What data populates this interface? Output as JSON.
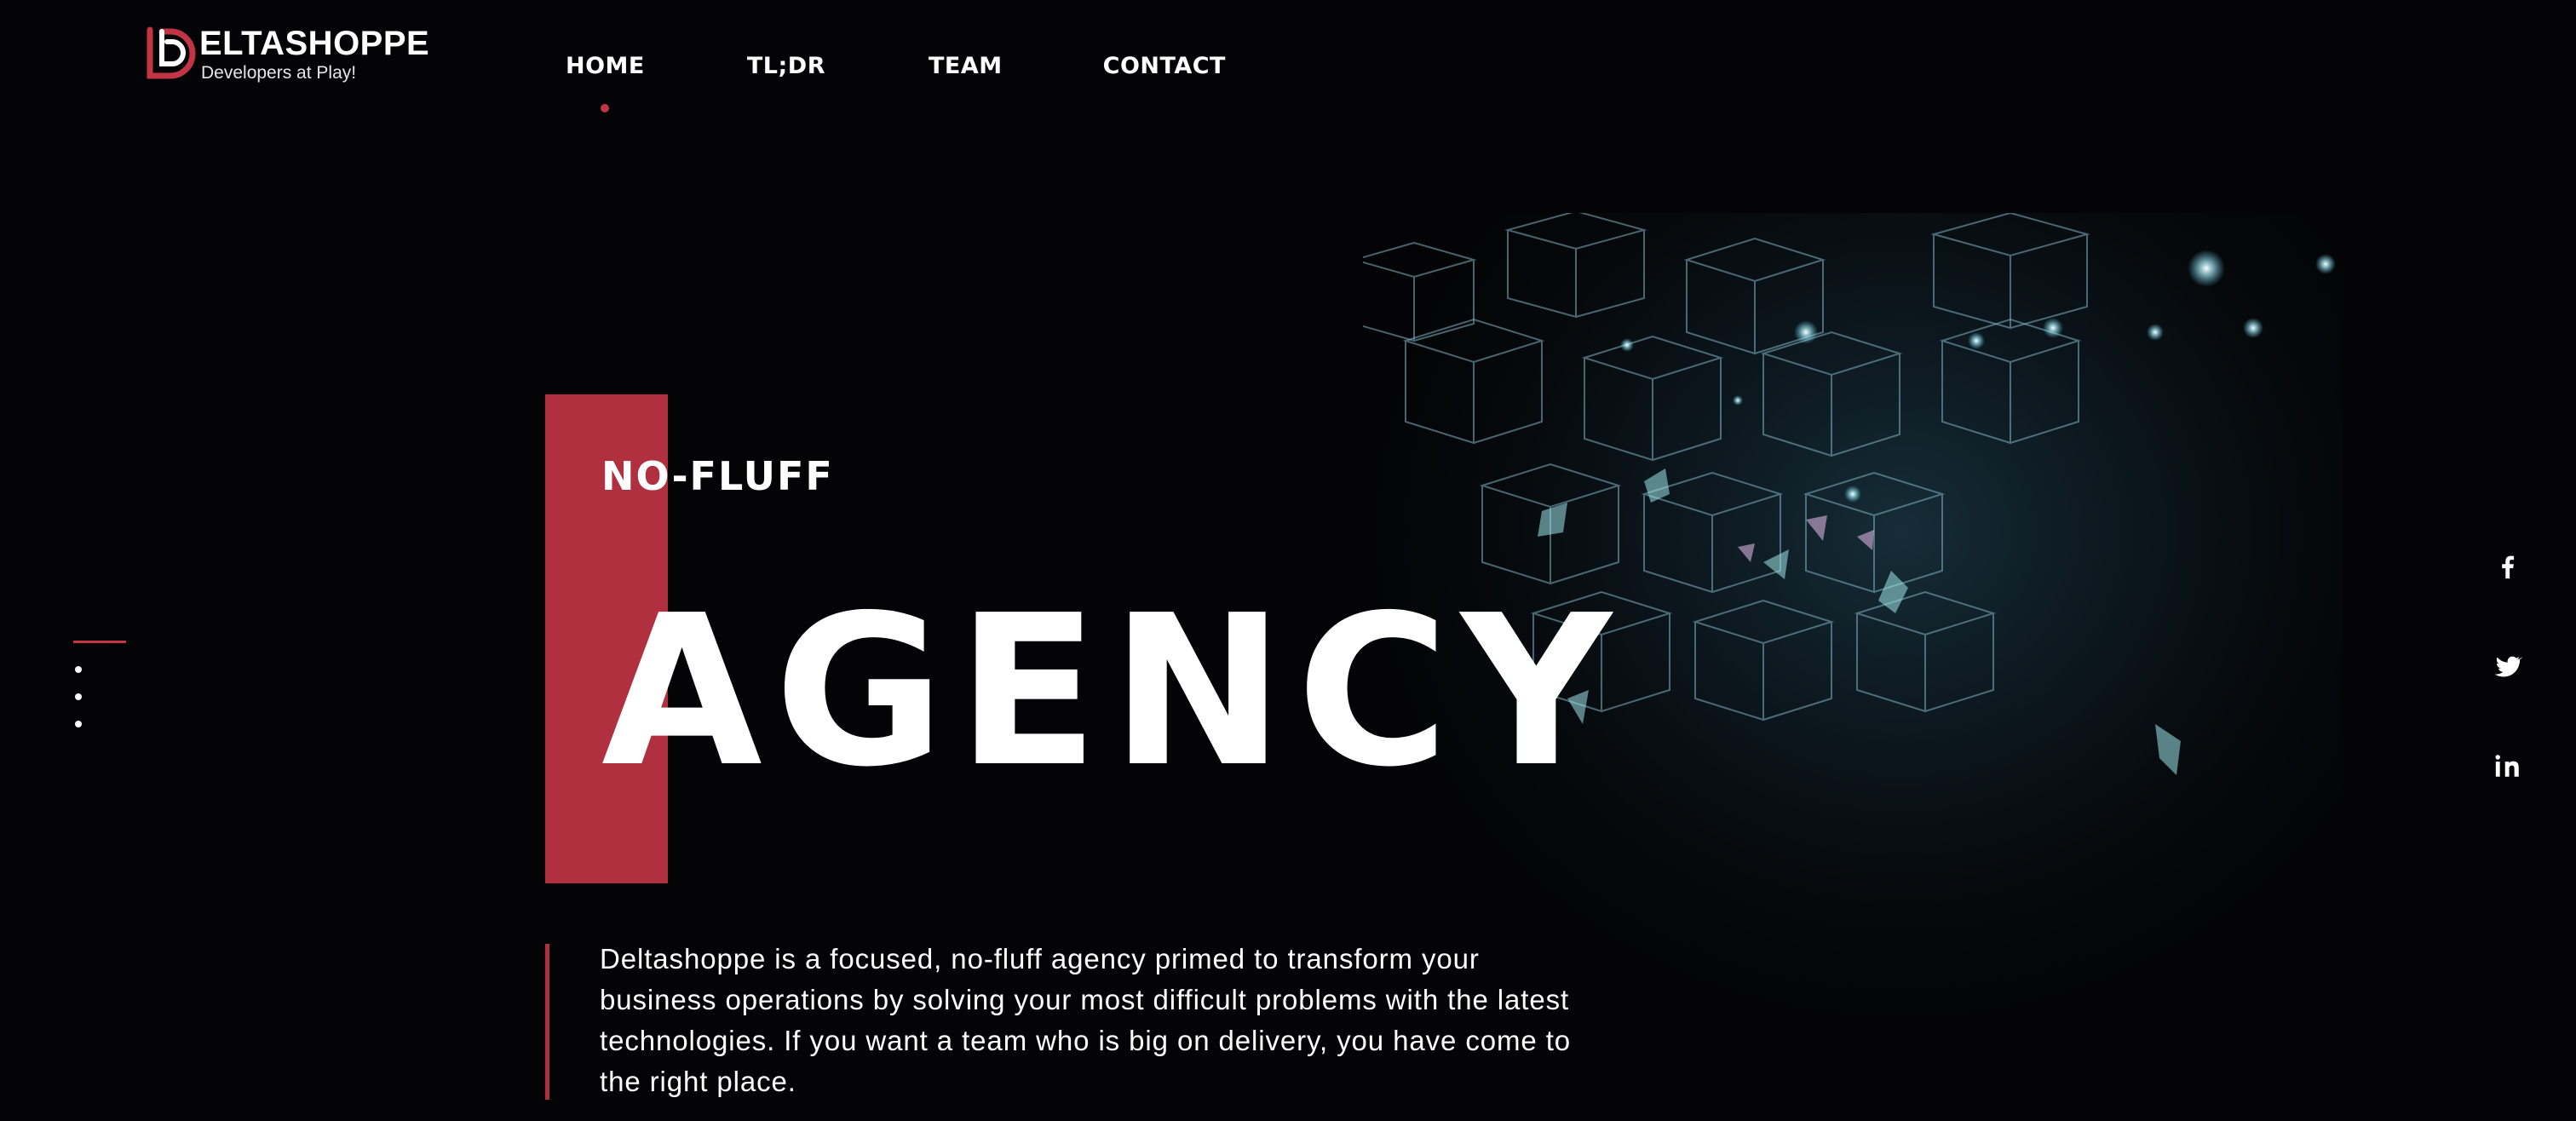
{
  "brand": {
    "name": "ELTASHOPPE",
    "tagline": "Developers at Play!",
    "accent_color": "#b0303f"
  },
  "nav": {
    "items": [
      {
        "label": "HOME",
        "active": true
      },
      {
        "label": "TL;DR",
        "active": false
      },
      {
        "label": "TEAM",
        "active": false
      },
      {
        "label": "CONTACT",
        "active": false
      }
    ]
  },
  "hero": {
    "kicker": "NO-FLUFF",
    "title": "AGENCY",
    "description": "Deltashoppe is a focused, no-fluff agency primed to transform your business operations by solving your most difficult problems with the latest technologies. If you want a team who is big on delivery, you have come to the right place."
  },
  "slider": {
    "slide_count": 3,
    "active_index": 0
  },
  "social": {
    "icons": [
      "facebook-icon",
      "twitter-icon",
      "linkedin-icon"
    ]
  }
}
